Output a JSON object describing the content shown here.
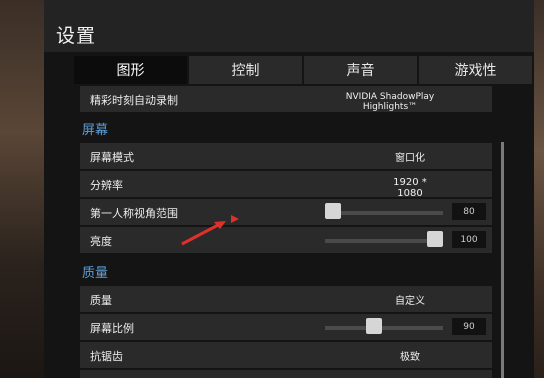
{
  "title": "设置",
  "tabs": [
    "图形",
    "控制",
    "声音",
    "游戏性"
  ],
  "rows": {
    "highlights": {
      "label": "精彩时刻自动录制",
      "value": "NVIDIA ShadowPlay Highlights™"
    },
    "screen_section": "屏幕",
    "screen_mode": {
      "label": "屏幕模式",
      "value": "窗口化"
    },
    "resolution": {
      "label": "分辨率",
      "value": "1920 * 1080"
    },
    "fov": {
      "label": "第一人称视角范围",
      "value": "80",
      "level": 0.0
    },
    "brightness": {
      "label": "亮度",
      "value": "100",
      "level": 1.0
    },
    "quality_section": "质量",
    "quality": {
      "label": "质量",
      "value": "自定义"
    },
    "screen_scale": {
      "label": "屏幕比例",
      "value": "90",
      "level": 0.4
    },
    "antialiasing": {
      "label": "抗锯齿",
      "value": "极致"
    }
  },
  "colors": {
    "accent": "#5d9ed8",
    "annotation": "#e0302a"
  },
  "annotation_icon": "red-arrow-icon"
}
